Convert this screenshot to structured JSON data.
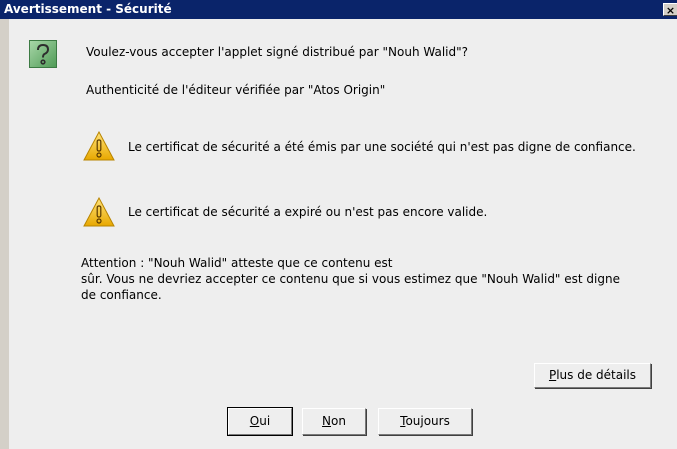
{
  "window": {
    "title": "Avertissement - Sécurité",
    "close_glyph": "×"
  },
  "dialog": {
    "question_icon": "question-icon",
    "question": "Voulez-vous accepter l'applet signé distribué par \"Nouh Walid\"?",
    "authenticity": "Authenticité de l'éditeur vérifiée par \"Atos Origin\"",
    "warnings": [
      {
        "icon": "warning-icon",
        "text": "Le certificat de sécurité a été émis par une société qui n'est pas digne de confiance."
      },
      {
        "icon": "warning-icon",
        "text": "Le certificat de sécurité a expiré ou n'est pas encore valide."
      }
    ],
    "attention_lines": [
      "Attention : \"Nouh Walid\" atteste que ce contenu est",
      "sûr. Vous ne devriez accepter ce contenu que si vous estimez que \"Nouh Walid\" est digne",
      "de confiance."
    ]
  },
  "buttons": {
    "details": {
      "mnemonic": "P",
      "rest": "lus de détails"
    },
    "oui": {
      "mnemonic": "O",
      "rest": "ui"
    },
    "non": {
      "mnemonic": "N",
      "rest": "on"
    },
    "toujours": {
      "mnemonic": "T",
      "rest": "oujours"
    }
  },
  "colors": {
    "titlebar": "#0a246a",
    "dialog_bg": "#eeeeee",
    "warning_yellow": "#f5c400"
  }
}
